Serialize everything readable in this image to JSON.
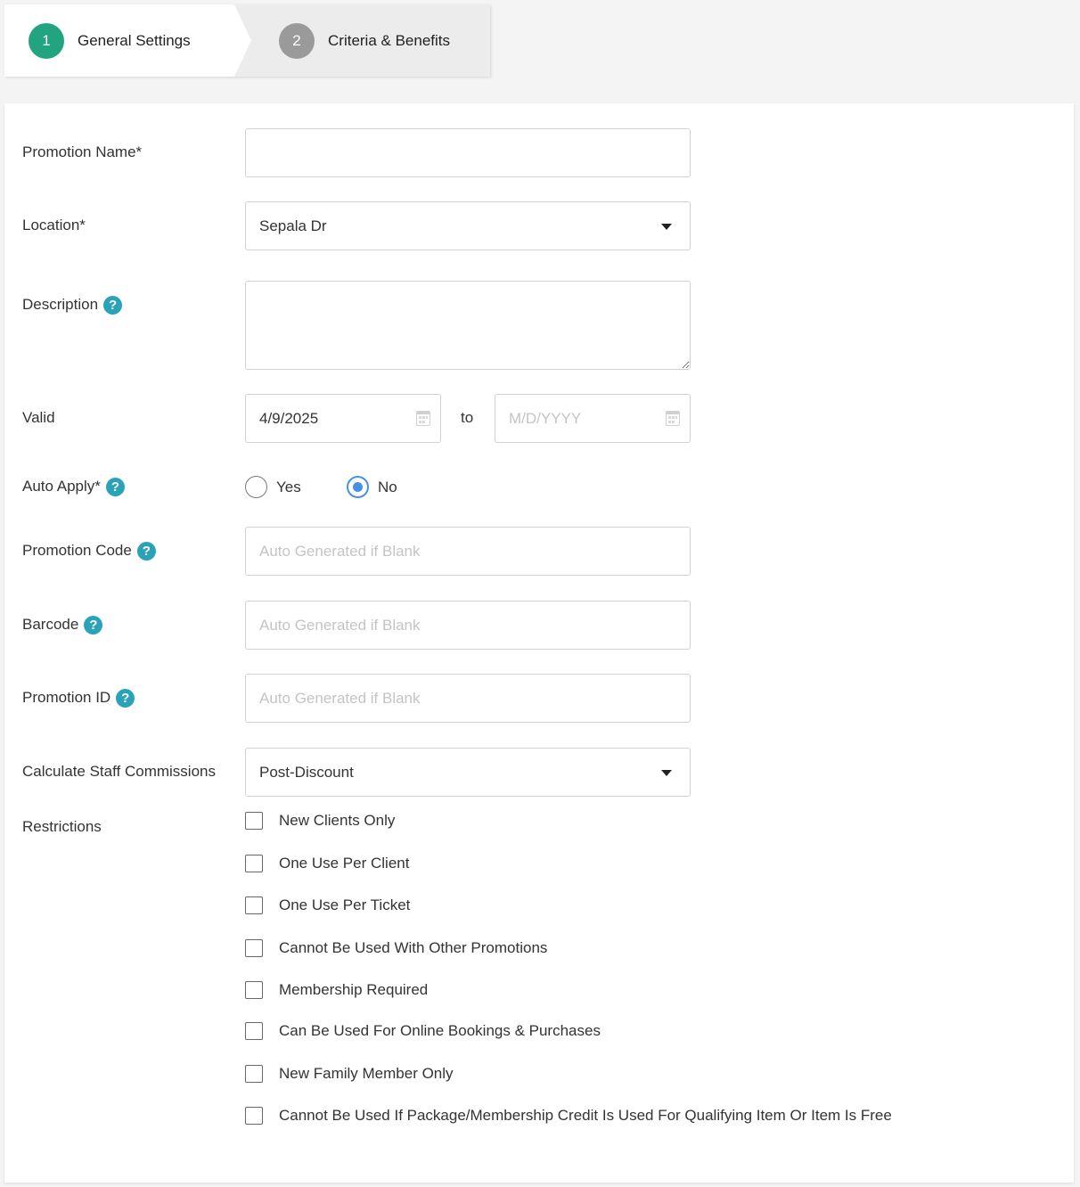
{
  "steps": [
    {
      "number": "1",
      "label": "General Settings"
    },
    {
      "number": "2",
      "label": "Criteria & Benefits"
    }
  ],
  "form": {
    "promotion_name": {
      "label": "Promotion Name*",
      "value": ""
    },
    "location": {
      "label": "Location*",
      "value": "Sepala Dr"
    },
    "description": {
      "label": "Description",
      "value": ""
    },
    "valid": {
      "label": "Valid",
      "from": "4/9/2025",
      "to_label": "to",
      "to_placeholder": "M/D/YYYY"
    },
    "auto_apply": {
      "label": "Auto Apply*",
      "options": [
        "Yes",
        "No"
      ],
      "selected": "No"
    },
    "promotion_code": {
      "label": "Promotion Code",
      "placeholder": "Auto Generated if Blank"
    },
    "barcode": {
      "label": "Barcode",
      "placeholder": "Auto Generated if Blank"
    },
    "promotion_id": {
      "label": "Promotion ID",
      "placeholder": "Auto Generated if Blank"
    },
    "staff_commissions": {
      "label": "Calculate Staff Commissions",
      "value": "Post-Discount"
    },
    "restrictions": {
      "label": "Restrictions",
      "items": [
        "New Clients Only",
        "One Use Per Client",
        "One Use Per Ticket",
        "Cannot Be Used With Other Promotions",
        "Membership Required",
        "Can Be Used For Online Bookings & Purchases",
        "New Family Member Only",
        "Cannot Be Used If Package/Membership Credit Is Used For Qualifying Item Or Item Is Free"
      ]
    }
  },
  "icons": {
    "help": "?"
  },
  "colors": {
    "step_active": "#21a47f",
    "step_inactive": "#9a9a9a",
    "help": "#2aa3b9",
    "radio_selected": "#4a90e2"
  }
}
